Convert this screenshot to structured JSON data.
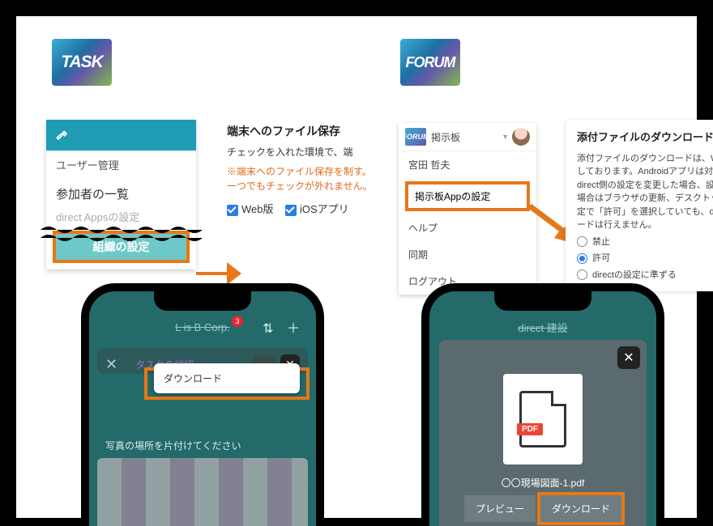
{
  "badges": {
    "task": "TASK",
    "forum": "FORUM"
  },
  "task_panel": {
    "heading": "ユーザー管理",
    "item1": "参加者の一覧",
    "faded": "direct Appsの設定",
    "highlight": "組織の設定"
  },
  "task_desc": {
    "title": "端末へのファイル保存",
    "line1": "チェックを入れた環境で、端",
    "warn": "※端末へのファイル保存を制す。一つでもチェックが外れません。",
    "check1": "Web版",
    "check2": "iOSアプリ"
  },
  "forum_panel": {
    "mini": "FORUM",
    "top_title": "掲示板",
    "user": "宮田 哲夫",
    "boxed": "掲示板Appの設定",
    "help": "ヘルプ",
    "sync": "同期",
    "logout": "ログアウト"
  },
  "forum_desc": {
    "title": "添付ファイルのダウンロード",
    "body": "添付ファイルのダウンロードは、Windoしております。Androidアプリは対応しdirect側の設定を変更した場合、設定の場合はブラウザの更新、デスクトッの設定で「許可」を選択していても、dンロードは行えません。",
    "r1": "禁止",
    "r2": "許可",
    "r3": "directの設定に準ずる"
  },
  "phone_left": {
    "header": "L is B Corp.",
    "badge_count": "3",
    "overlay_label": "タスクの詳細",
    "download": "ダウンロード",
    "body": "写真の場所を片付けてください"
  },
  "phone_right": {
    "header": "direct 建設",
    "pdf_tag": "PDF",
    "filename": "〇〇現場図面-1.pdf",
    "btn_preview": "プレビュー",
    "btn_download": "ダウンロード"
  }
}
